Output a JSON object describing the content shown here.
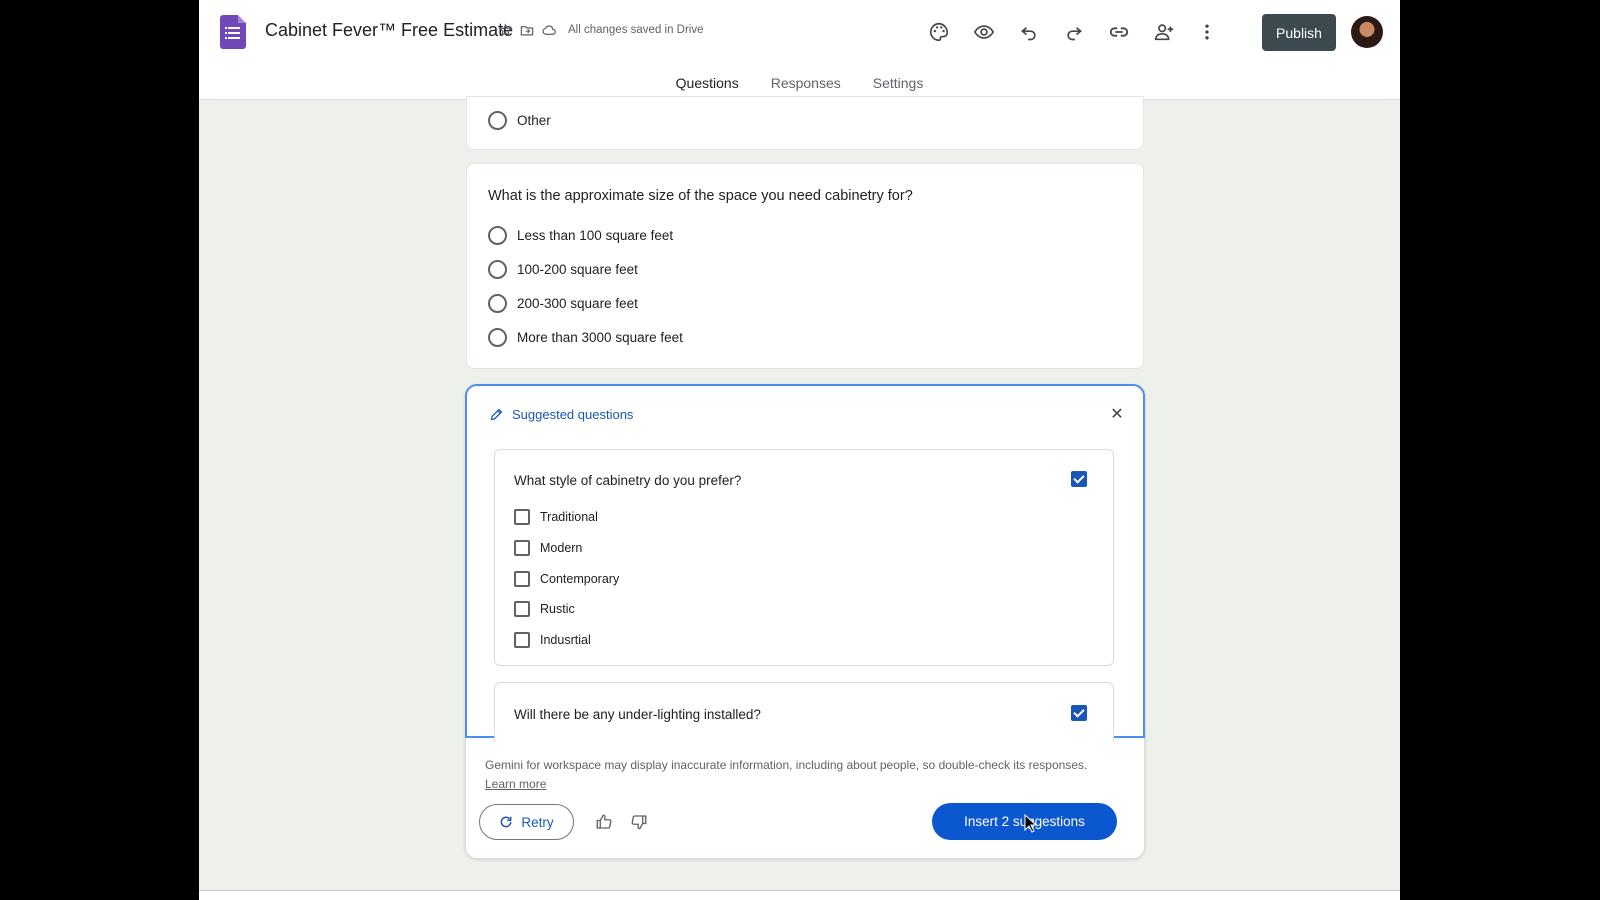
{
  "header": {
    "title": "Cabinet Fever™ Free Estimate",
    "saved_status": "All changes saved in Drive",
    "publish_label": "Publish",
    "tabs": [
      {
        "label": "Questions",
        "active": true
      },
      {
        "label": "Responses",
        "active": false
      },
      {
        "label": "Settings",
        "active": false
      }
    ]
  },
  "prev_card": {
    "option": "Other"
  },
  "size_question": {
    "title": "What is the approximate size of the space you need cabinetry for?",
    "options": [
      "Less than 100 square feet",
      "100-200 square feet",
      "200-300 square feet",
      "More than 3000 square feet"
    ]
  },
  "suggestions": {
    "heading": "Suggested questions",
    "items": [
      {
        "title": "What style of cabinetry do you prefer?",
        "selected": true,
        "options": [
          "Traditional",
          "Modern",
          "Contemporary",
          "Rustic",
          "Indusrtial"
        ]
      },
      {
        "title": "Will there be any under-lighting installed?",
        "selected": true
      }
    ],
    "disclaimer": "Gemini for workspace may display inaccurate information, including about people, so double-check its responses.",
    "learn_more": "Learn more",
    "retry_label": "Retry",
    "insert_label": "Insert 2 suggestions"
  },
  "colors": {
    "accent_blue": "#0b57d0",
    "publish_bg": "#3c4a4f",
    "forms_purple": "#7248b9",
    "page_bg": "#eef0ec"
  }
}
